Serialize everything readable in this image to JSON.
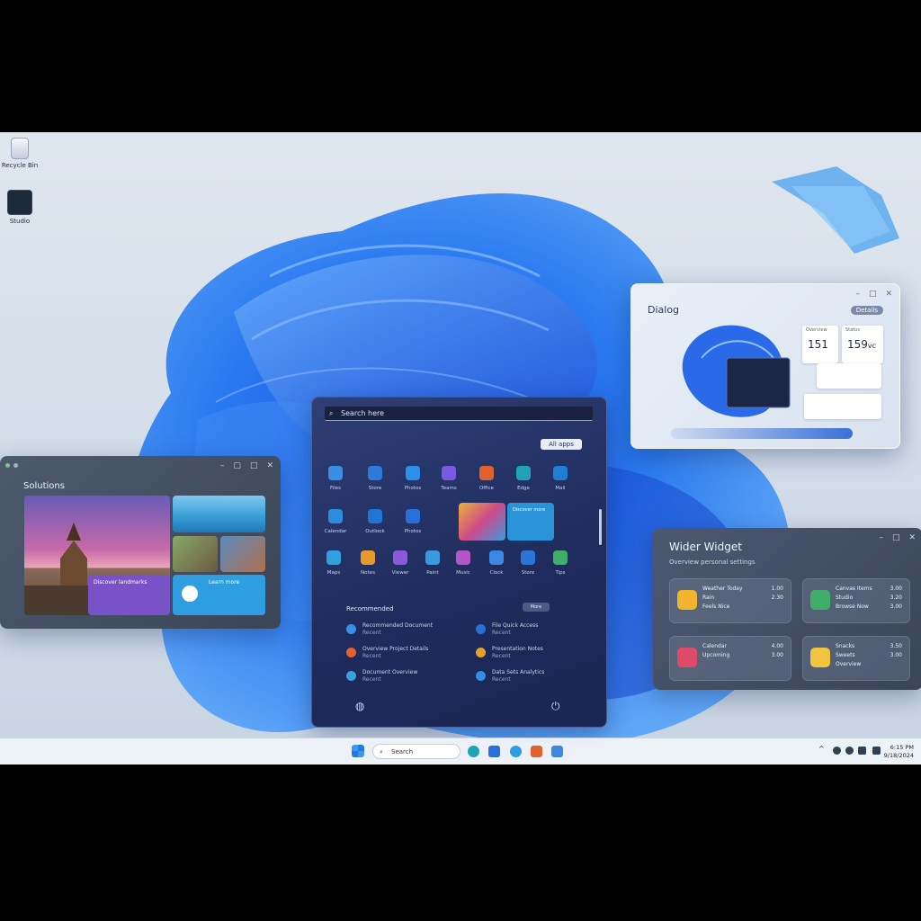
{
  "desktop": {
    "icons": [
      {
        "label": "Recycle Bin",
        "icon": "recycle-bin-icon"
      },
      {
        "label": "Studio",
        "icon": "app-shortcut-icon"
      }
    ]
  },
  "left_window": {
    "title": "Solutions",
    "tiles": [
      {
        "text": "Discover landmarks"
      },
      {
        "text": "Learn more",
        "sub": "Connect"
      },
      {
        "text": "Discover more"
      }
    ]
  },
  "start_menu": {
    "search_placeholder": "Search here",
    "all_apps_label": "All apps",
    "apps": [
      {
        "label": "Files",
        "color": "#3a8ee6"
      },
      {
        "label": "Store",
        "color": "#2d7ad8"
      },
      {
        "label": "Photos",
        "color": "#2c8fe8"
      },
      {
        "label": "Teams",
        "color": "#7a5ae0"
      },
      {
        "label": "Office",
        "color": "#e0622e"
      },
      {
        "label": "Edge",
        "color": "#1fa3b5"
      },
      {
        "label": "Mail",
        "color": "#1e7fd6"
      },
      {
        "label": "Calendar",
        "color": "#2a8de0"
      },
      {
        "label": "Outlook",
        "color": "#1f74d8"
      },
      {
        "label": "Photos",
        "color": "#2a6fd8"
      },
      {
        "label": "Maps",
        "color": "#2fa0e0"
      },
      {
        "label": "Notes",
        "color": "#e69a2e"
      },
      {
        "label": "Viewer",
        "color": "#8a5ad8"
      },
      {
        "label": "Paint",
        "color": "#3a9ae0"
      },
      {
        "label": "Music",
        "color": "#b455c8"
      },
      {
        "label": "Clock",
        "color": "#3a88e0"
      },
      {
        "label": "Store",
        "color": "#2a76d8"
      },
      {
        "label": "Tips",
        "color": "#3fae6a"
      }
    ],
    "featured_tile_text": "Discover more",
    "recommended_title": "Recommended",
    "more_label": "More",
    "recommended": [
      {
        "title": "Recommended Document",
        "sub": "Recent",
        "color": "#3a8ee6"
      },
      {
        "title": "File Quick Access",
        "sub": "Recent",
        "color": "#2a6fd8"
      },
      {
        "title": "Overview Project Details",
        "sub": "Recent",
        "color": "#e0622e"
      },
      {
        "title": "Presentation Notes",
        "sub": "Recent",
        "color": "#e6a22e"
      },
      {
        "title": "Document Overview",
        "sub": "Recent",
        "color": "#3aa0e0"
      },
      {
        "title": "Data Sets Analytics",
        "sub": "Recent",
        "color": "#2f8fe0"
      }
    ]
  },
  "right_window": {
    "title": "Dialog",
    "badge": "Details",
    "stat_labels": [
      "Overview",
      "Status"
    ],
    "stat_values": [
      "151",
      "159"
    ],
    "stat_unit": "vc"
  },
  "widget_window": {
    "title": "Wider Widget",
    "subtitle": "Overview personal settings",
    "cards": [
      {
        "name": "Weather Today",
        "lines": [
          "Rain",
          "Feels Nice"
        ],
        "values": [
          "1.00",
          "2.30"
        ],
        "color": "#f2b32e"
      },
      {
        "name": "Canvas Items",
        "lines": [
          "Studio",
          "Browse Now"
        ],
        "values": [
          "3.00",
          "3.20",
          "3.00"
        ],
        "color": "#3fae6a"
      },
      {
        "name": "Calendar",
        "lines": [
          "Upcoming"
        ],
        "values": [
          "4.00",
          "3.00"
        ],
        "color": "#e04a6a"
      },
      {
        "name": "Snacks",
        "lines": [
          "Sweets",
          "Overview"
        ],
        "values": [
          "3.50",
          "3.00"
        ],
        "color": "#f0c43e"
      }
    ]
  },
  "taskbar": {
    "search_placeholder": "Search",
    "time": "6:15 PM",
    "date": "9/18/2024"
  }
}
